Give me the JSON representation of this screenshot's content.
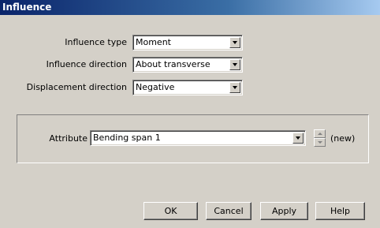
{
  "window": {
    "title": "Influence"
  },
  "form": {
    "influence_type": {
      "label": "Influence type",
      "value": "Moment"
    },
    "influence_direction": {
      "label": "Influence direction",
      "value": "About transverse"
    },
    "displacement_direction": {
      "label": "Displacement direction",
      "value": "Negative"
    }
  },
  "attribute": {
    "label": "Attribute",
    "value": "Bending span 1",
    "new_label": "(new)"
  },
  "buttons": {
    "ok": "OK",
    "cancel": "Cancel",
    "apply": "Apply",
    "help": "Help"
  },
  "icons": [
    "chevron-down-icon",
    "spin-up-icon",
    "spin-down-icon"
  ],
  "colors": {
    "titlebar_start": "#0a246a",
    "titlebar_end": "#a6caf0",
    "dialog_bg": "#d4d0c8"
  }
}
